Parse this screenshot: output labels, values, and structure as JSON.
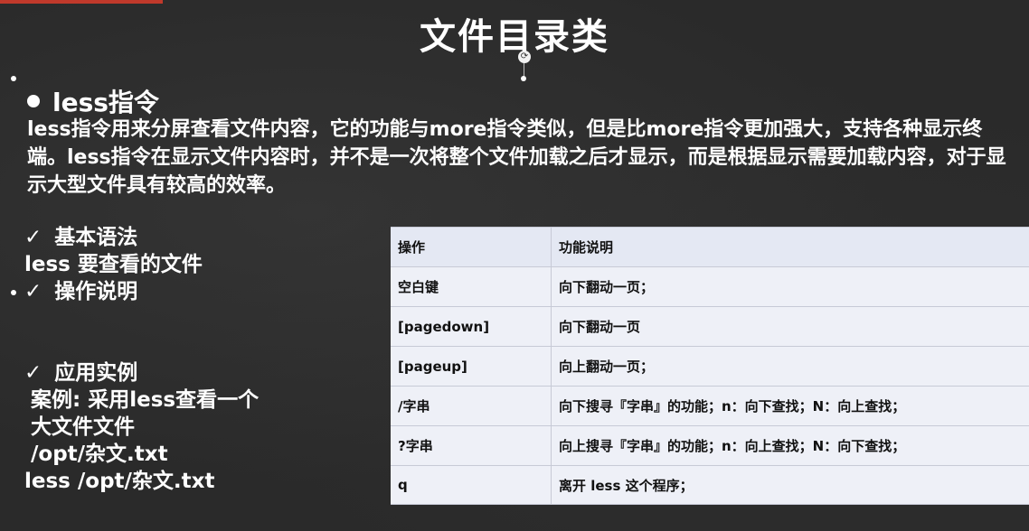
{
  "slide": {
    "title": "文件目录类",
    "heading": "less指令",
    "description": "less指令用来分屏查看文件内容，它的功能与more指令类似，但是比more指令更加强大，支持各种显示终端。less指令在显示文件内容时，并不是一次将整个文件加载之后才显示，而是根据显示需要加载内容，对于显示大型文件具有较高的效率。",
    "basic_syntax_label": "基本语法",
    "basic_syntax_value": "less 要查看的文件",
    "operations_label": "操作说明",
    "example_label": "应用实例",
    "example_lines": [
      "案例: 采用less查看一个",
      "大文件文件",
      "/opt/杂文.txt"
    ],
    "example_command": "less /opt/杂文.txt"
  },
  "table": {
    "header": [
      "操作",
      "功能说明"
    ],
    "rows": [
      [
        "空白键",
        "向下翻动一页；"
      ],
      [
        "[pagedown]",
        "向下翻动一页"
      ],
      [
        "[pageup]",
        "向上翻动一页；"
      ],
      [
        "/字串",
        "向下搜寻『字串』的功能；n：向下查找；N：向上查找；"
      ],
      [
        "?字串",
        "向上搜寻『字串』的功能；n：向上查找；N：向下查找；"
      ],
      [
        "q",
        "离开 less 这个程序；"
      ]
    ]
  },
  "icons": {
    "bullet": "bullet-dot-icon",
    "check": "check-mark-icon",
    "rotate": "rotate-handle-icon"
  },
  "colors": {
    "background": "#2a2a2a",
    "table_bg": "#eef0f7",
    "text": "#ffffff"
  }
}
